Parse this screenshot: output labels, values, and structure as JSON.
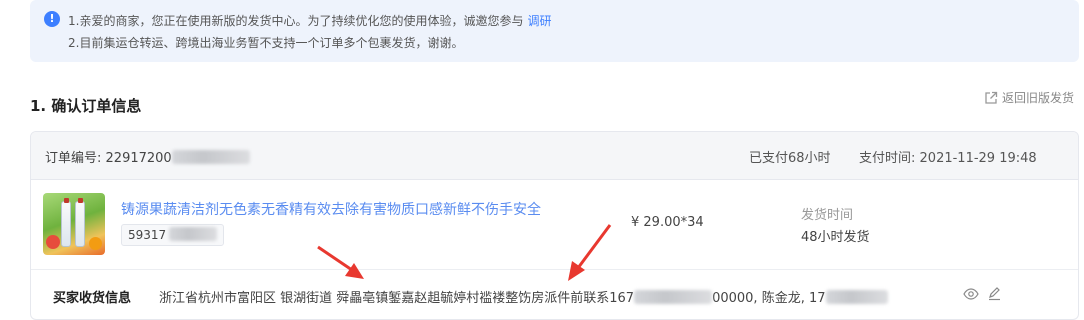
{
  "notice": {
    "line1": "1.亲爱的商家，您正在使用新版的发货中心。为了持续优化您的使用体验，诚邀您参与",
    "survey_link": "调研",
    "line2": "2.目前集运仓转运、跨境出海业务暂不支持一个订单多个包裹发货，谢谢。"
  },
  "section_title": "1. 确认订单信息",
  "back_old_label": "返回旧版发货",
  "order": {
    "number_label": "订单编号:",
    "number_visible": "22917200",
    "paid_duration": "已支付68小时",
    "pay_time_label": "支付时间:",
    "pay_time": "2021-11-29 19:48"
  },
  "product": {
    "name": "铸源果蔬清洁剂无色素无香精有效去除有害物质口感新鲜不伤手安全",
    "sku_visible": "59317",
    "price": "¥ 29.00*34",
    "ship_label": "发货时间",
    "ship_value": "48小时发货"
  },
  "buyer": {
    "label": "买家收货信息",
    "address_part1": "浙江省杭州市富阳区 银湖街道 舜畾亳镇錾嘉赵趄毓婷村褴褛整饬房派件前联系167",
    "address_part2": "00000, 陈金龙, 17"
  },
  "icons": {
    "info": "info-icon",
    "external": "external-link-icon",
    "eye": "eye-icon",
    "edit": "edit-icon"
  },
  "colors": {
    "accent": "#3d7fff",
    "product_link": "#5a8cf0",
    "arrow": "#e8382f",
    "notice_bg": "#eef3fc"
  }
}
